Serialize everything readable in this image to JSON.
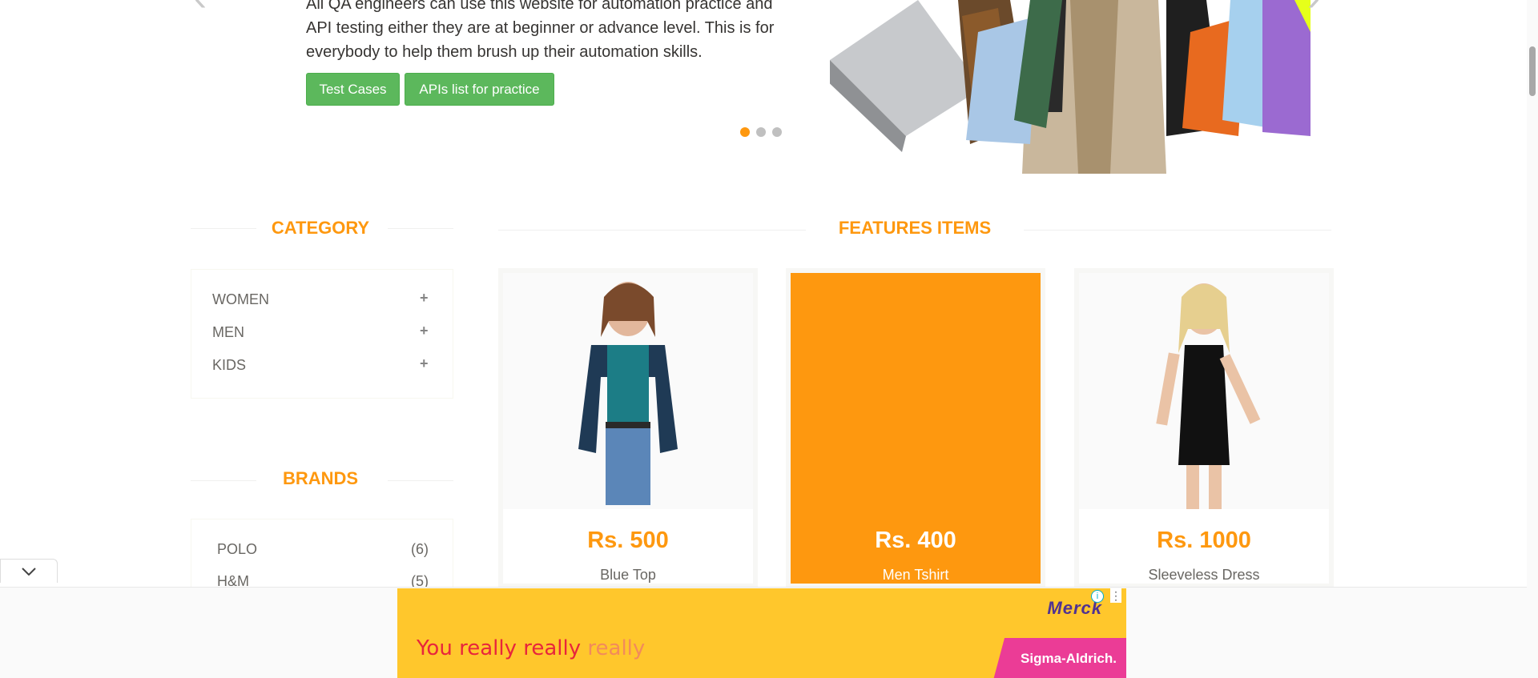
{
  "carousel": {
    "description_lines": [
      "All QA engineers can use this website for automation practice and",
      "API testing either they are at beginner or advance level. This is for",
      "everybody to help them brush up their automation skills."
    ],
    "buttons": {
      "test_cases": "Test Cases",
      "apis_list": "APIs list for practice"
    },
    "indicators": {
      "count": 3,
      "active_index": 0
    },
    "prev_icon": "chevron-left",
    "next_icon": "chevron-right"
  },
  "category": {
    "title": "CATEGORY",
    "items": [
      {
        "label": "WOMEN",
        "icon": "plus"
      },
      {
        "label": "MEN",
        "icon": "plus"
      },
      {
        "label": "KIDS",
        "icon": "plus"
      }
    ]
  },
  "brands": {
    "title": "BRANDS",
    "items": [
      {
        "label": "POLO",
        "count": "(6)"
      },
      {
        "label": "H&M",
        "count": "(5)"
      }
    ]
  },
  "features": {
    "title": "FEATURES ITEMS",
    "products": [
      {
        "price": "Rs. 500",
        "name": "Blue Top"
      },
      {
        "price": "Rs. 400",
        "name": "Men Tshirt"
      },
      {
        "price": "Rs. 1000",
        "name": "Sleeveless Dress"
      }
    ]
  },
  "ad": {
    "text_parts": [
      "You really ",
      "really ",
      "really"
    ],
    "brand": "Merck",
    "sub_brand": "Sigma-Aldrich.",
    "info_icon": "info-icon",
    "more_icon": "more-vertical-icon",
    "collapse_icon": "chevron-down"
  },
  "colors": {
    "accent": "#fe980f",
    "button_green": "#5cb85c",
    "ad_yellow": "#ffc72c"
  }
}
